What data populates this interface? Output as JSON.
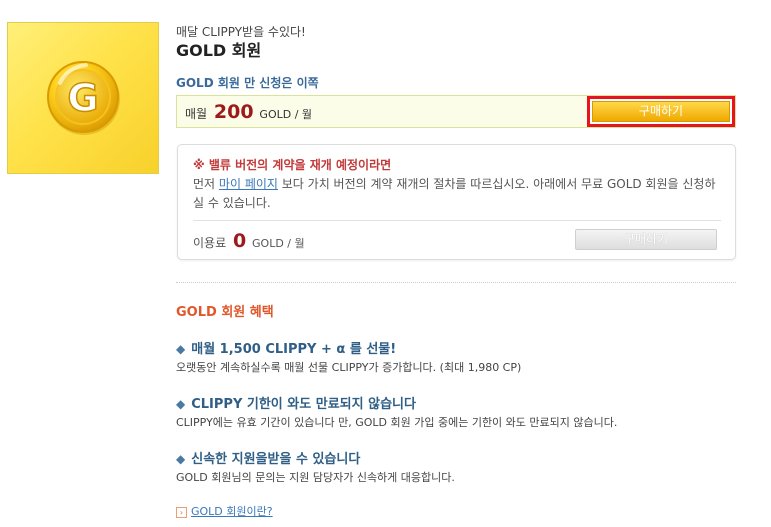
{
  "header": {
    "subtitle": "매달 CLIPPY받을 수있다!",
    "title": "GOLD 회원"
  },
  "tile": {
    "coin_letter": "G"
  },
  "apply": {
    "note": "GOLD 회원 만 신청은 이쪽",
    "price_prefix": "매월",
    "price_value": "200",
    "price_unit": "GOLD / 월",
    "buy_label": "구매하기"
  },
  "notice": {
    "title": "※ 밸류 버전의 계약을 재개 예정이라면",
    "body_before": "먼저",
    "link_text": "마이 페이지",
    "body_after": "보다 가치 버전의 계약 재개의 절차를 따르십시오. 아래에서 무료 GOLD 회원을 신청하실 수 있습니다.",
    "price_prefix": "이용료",
    "price_value": "0",
    "price_unit": "GOLD / 월",
    "buy_label": "구매하기"
  },
  "benefits": {
    "heading": "GOLD 회원 혜택",
    "bullet": "◆",
    "items": [
      {
        "title": "매월 1,500 CLIPPY + α 를 선물!",
        "desc": "오랫동안 계속하실수록 매월 선물 CLIPPY가 증가합니다. (최대 1,980 CP)"
      },
      {
        "title": "CLIPPY 기한이 와도 만료되지 않습니다",
        "desc": "CLIPPY에는 유효 기간이 있습니다 만, GOLD 회원 가입 중에는 기한이 와도 만료되지 않습니다."
      },
      {
        "title": "신속한 지원을받을 수 있습니다",
        "desc": "GOLD 회원님의 문의는 지원 담당자가 신속하게 대응합니다."
      }
    ]
  },
  "footer_link": {
    "arrow": "›",
    "label": "GOLD 회원이란?"
  },
  "colors": {
    "accent_gold": "#f0a800",
    "highlight_red": "#e8141d",
    "heading_orange": "#e0582a",
    "link_blue": "#3a78b8"
  }
}
